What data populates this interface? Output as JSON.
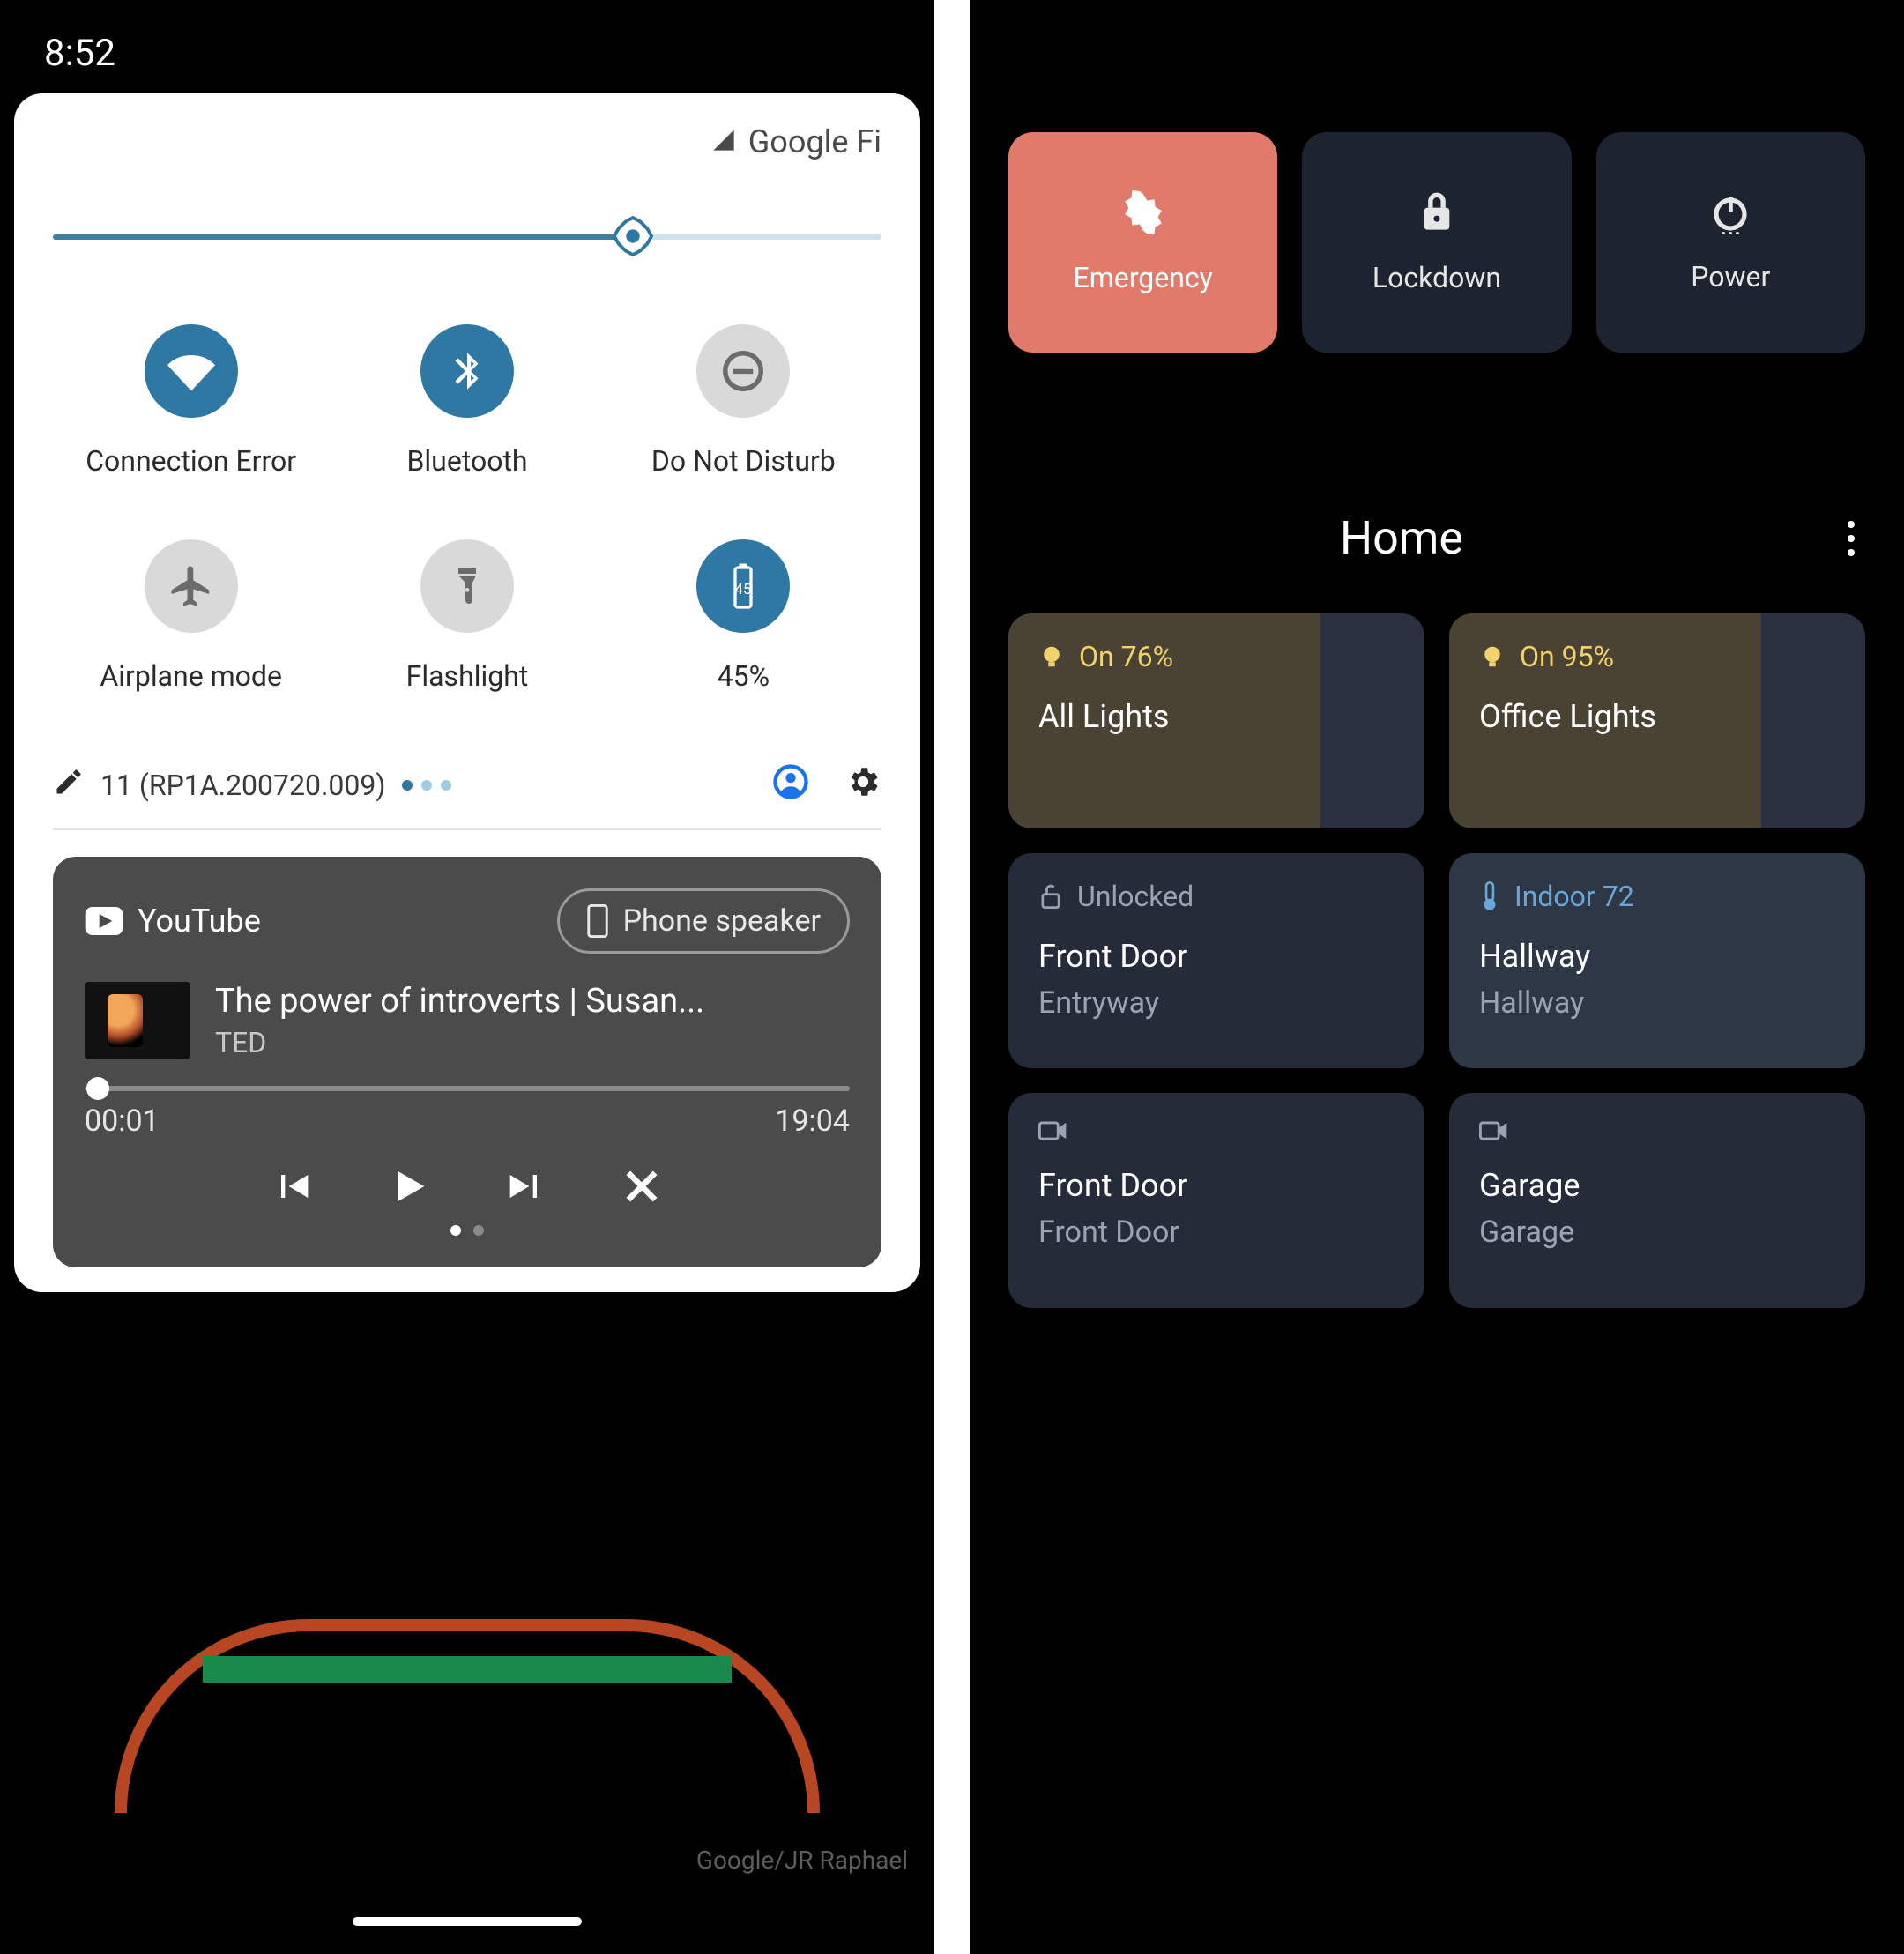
{
  "left": {
    "time": "8:52",
    "carrier": "Google Fi",
    "brightness_pct": 70,
    "tiles": [
      {
        "label": "Connection Error",
        "icon": "wifi-icon",
        "active": true
      },
      {
        "label": "Bluetooth",
        "icon": "bluetooth-icon",
        "active": true
      },
      {
        "label": "Do Not Disturb",
        "icon": "dnd-icon",
        "active": false
      },
      {
        "label": "Airplane mode",
        "icon": "airplane-icon",
        "active": false
      },
      {
        "label": "Flashlight",
        "icon": "flashlight-icon",
        "active": false
      },
      {
        "label": "45%",
        "icon": "battery-icon",
        "active": true
      }
    ],
    "battery_badge": "45",
    "build": "11 (RP1A.200720.009)",
    "media": {
      "source": "YouTube",
      "output": "Phone speaker",
      "title": "The power of introverts | Susan...",
      "subtitle": "TED",
      "elapsed": "00:01",
      "total": "19:04"
    },
    "credit": "Google/JR Raphael"
  },
  "right": {
    "power": [
      {
        "label": "Emergency",
        "icon": "medical-icon",
        "style": "emergency"
      },
      {
        "label": "Lockdown",
        "icon": "lock-icon",
        "style": "dark"
      },
      {
        "label": "Power",
        "icon": "power-icon",
        "style": "dark"
      }
    ],
    "home_title": "Home",
    "devices": [
      {
        "status": "On 76%",
        "name": "All Lights",
        "sub": "",
        "variant": "light",
        "statusStyle": "yellow",
        "icon": "bulb-icon"
      },
      {
        "status": "On 95%",
        "name": "Office Lights",
        "sub": "",
        "variant": "light",
        "statusStyle": "yellow",
        "icon": "bulb-icon"
      },
      {
        "status": "Unlocked",
        "name": "Front Door",
        "sub": "Entryway",
        "variant": "dark",
        "statusStyle": "grey",
        "icon": "unlock-icon"
      },
      {
        "status": "Indoor 72",
        "name": "Hallway",
        "sub": "Hallway",
        "variant": "therm",
        "statusStyle": "blue",
        "icon": "thermostat-icon"
      },
      {
        "status": "",
        "name": "Front Door",
        "sub": "Front Door",
        "variant": "dark",
        "statusStyle": "grey",
        "icon": "camera-icon"
      },
      {
        "status": "",
        "name": "Garage",
        "sub": "Garage",
        "variant": "dark",
        "statusStyle": "grey",
        "icon": "camera-icon"
      }
    ]
  }
}
